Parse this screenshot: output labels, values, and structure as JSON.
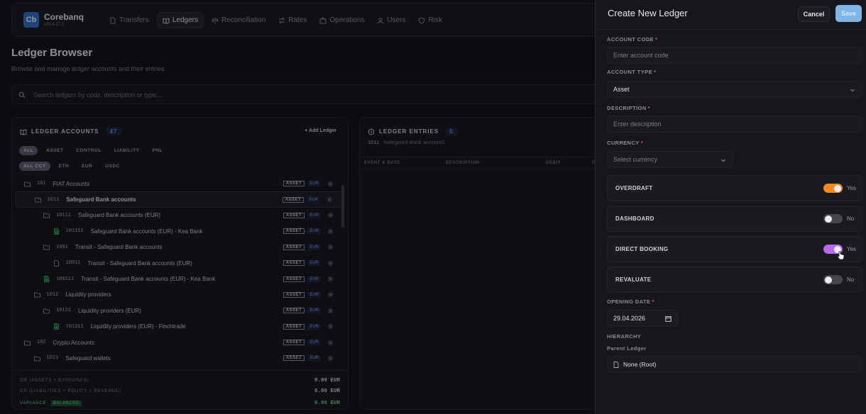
{
  "app": {
    "name": "Corebanq",
    "logo_text": "Cb",
    "version": "v26.4.27.2"
  },
  "nav": [
    {
      "label": "Transfers",
      "icon": "document-icon",
      "active": false
    },
    {
      "label": "Ledgers",
      "icon": "book-icon",
      "active": true
    },
    {
      "label": "Reconciliation",
      "icon": "scale-icon",
      "active": false
    },
    {
      "label": "Rates",
      "icon": "exchange-icon",
      "active": false
    },
    {
      "label": "Operations",
      "icon": "briefcase-icon",
      "active": false
    },
    {
      "label": "Users",
      "icon": "user-icon",
      "active": false
    },
    {
      "label": "Risk",
      "icon": "shield-icon",
      "active": false
    }
  ],
  "page": {
    "title": "Ledger Browser",
    "subtitle": "Browse and manage ledger accounts and their entries",
    "search_placeholder": "Search ledgers by code, description or type..."
  },
  "accounts": {
    "title": "LEDGER ACCOUNTS",
    "count": "47",
    "add_label": "+ Add Ledger",
    "type_filters": [
      "ALL",
      "ASSET",
      "CONTROL",
      "LIABILITY",
      "PNL"
    ],
    "currency_filters": [
      "ALL CCY",
      "ETH",
      "EUR",
      "USDC"
    ],
    "rows": [
      {
        "code": "101",
        "label": "FIAT Accounts",
        "type": "folder",
        "depth": 1,
        "tag": "ASSET",
        "ccy": "EUR"
      },
      {
        "code": "1011",
        "label": "Safeguard Bank accounts",
        "type": "folder",
        "depth": 2,
        "tag": "ASSET",
        "ccy": "EUR",
        "selected": true
      },
      {
        "code": "10111",
        "label": "Safeguard Bank accounts (EUR)",
        "type": "folder",
        "depth": 3,
        "tag": "ASSET",
        "ccy": "EUR"
      },
      {
        "code": "101111",
        "label": "Safeguard Bank accounts (EUR) - Kea Bank",
        "type": "file-green",
        "depth": 4,
        "tag": "ASSET",
        "ccy": "EUR"
      },
      {
        "code": "1091",
        "label": "Transit - Safeguard Bank accounts",
        "type": "folder",
        "depth": 3,
        "tag": "ASSET",
        "ccy": "EUR"
      },
      {
        "code": "10911",
        "label": "Transit - Safeguard Bank accounts (EUR)",
        "type": "file-gray",
        "depth": 4,
        "tag": "ASSET",
        "ccy": "EUR"
      },
      {
        "code": "109111",
        "label": "Transit - Safeguard Bank accounts (EUR) - Kea Bank",
        "type": "file-green",
        "depth": 3,
        "tag": "ASSET",
        "ccy": "EUR"
      },
      {
        "code": "1012",
        "label": "Liquidity providers",
        "type": "folder",
        "depth": 2,
        "tag": "ASSET",
        "ccy": "EUR"
      },
      {
        "code": "10121",
        "label": "Liquidity providers (EUR)",
        "type": "folder",
        "depth": 3,
        "tag": "ASSET",
        "ccy": "EUR"
      },
      {
        "code": "101211",
        "label": "Liquidity providers (EUR) - Finchtrade",
        "type": "file-green",
        "depth": 4,
        "tag": "ASSET",
        "ccy": "EUR"
      },
      {
        "code": "102",
        "label": "Crypto Accounts",
        "type": "folder",
        "depth": 1,
        "tag": "ASSET",
        "ccy": "EUR"
      },
      {
        "code": "1021",
        "label": "Safeguard wallets",
        "type": "folder",
        "depth": 2,
        "tag": "ASSET",
        "ccy": "EUR"
      }
    ],
    "totals": {
      "dr_label": "DR (ASSETS + EXPENSES)",
      "dr_value": "0.00 EUR",
      "cr_label": "CR (LIABILITIES + EQUITY + REVENUE)",
      "cr_value": "0.00 EUR",
      "variance_label": "VARIANCE",
      "variance_badge": "BALANCED",
      "variance_value": "0.00 EUR"
    }
  },
  "entries": {
    "title": "LEDGER ENTRIES",
    "count": "0",
    "sub_code": "1011",
    "sub_label": "Safeguard Bank accounts",
    "columns": [
      "EVENT & DATE",
      "DESCRIPTION",
      "DEBIT",
      "C"
    ]
  },
  "drawer": {
    "title": "Create New Ledger",
    "cancel": "Cancel",
    "save": "Save",
    "account_code_label": "ACCOUNT CODE",
    "account_code_placeholder": "Enter account code",
    "account_type_label": "ACCOUNT TYPE",
    "account_type_value": "Asset",
    "description_label": "DESCRIPTION",
    "description_placeholder": "Enter description",
    "currency_label": "CURRENCY",
    "currency_placeholder": "Select currency",
    "req": "*",
    "toggles": [
      {
        "label": "OVERDRAFT",
        "on": true,
        "state": "Yes",
        "color": "#f28a24"
      },
      {
        "label": "DASHBOARD",
        "on": false,
        "state": "No",
        "color": "#47464f"
      },
      {
        "label": "DIRECT BOOKING",
        "on": true,
        "state": "Yes",
        "color": "#b76be8"
      },
      {
        "label": "REVALUATE",
        "on": false,
        "state": "No",
        "color": "#47464f"
      }
    ],
    "opening_date_label": "OPENING DATE",
    "opening_date_value": "29.04.2026",
    "hierarchy_label": "HIERARCHY",
    "parent_label": "Parent Ledger",
    "parent_value": "None (Root)"
  }
}
